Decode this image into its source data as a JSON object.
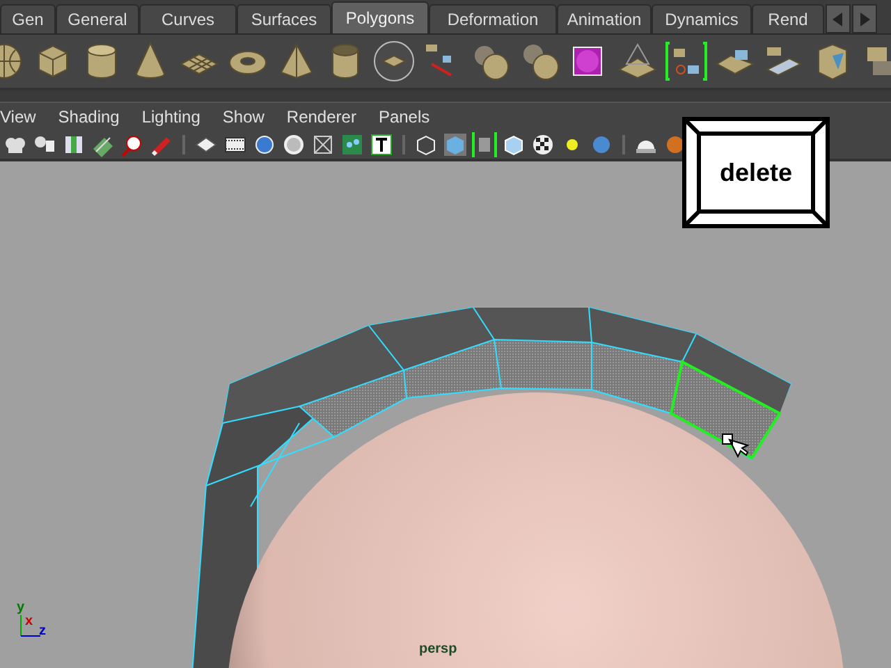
{
  "shelf_tabs": [
    {
      "label": "Gen",
      "selected": false
    },
    {
      "label": "General",
      "selected": false
    },
    {
      "label": "Curves",
      "selected": false
    },
    {
      "label": "Surfaces",
      "selected": false
    },
    {
      "label": "Polygons",
      "selected": true
    },
    {
      "label": "Deformation",
      "selected": false
    },
    {
      "label": "Animation",
      "selected": false
    },
    {
      "label": "Dynamics",
      "selected": false
    },
    {
      "label": "Rend",
      "selected": false
    }
  ],
  "panel_menu": [
    "View",
    "Shading",
    "Lighting",
    "Show",
    "Renderer",
    "Panels"
  ],
  "viewport": {
    "camera": "persp",
    "axes": [
      {
        "label": "y",
        "color": "#007a00"
      },
      {
        "label": "x",
        "color": "#cc0000"
      },
      {
        "label": "z",
        "color": "#0000cc"
      }
    ]
  },
  "key_overlay": {
    "label": "delete"
  }
}
